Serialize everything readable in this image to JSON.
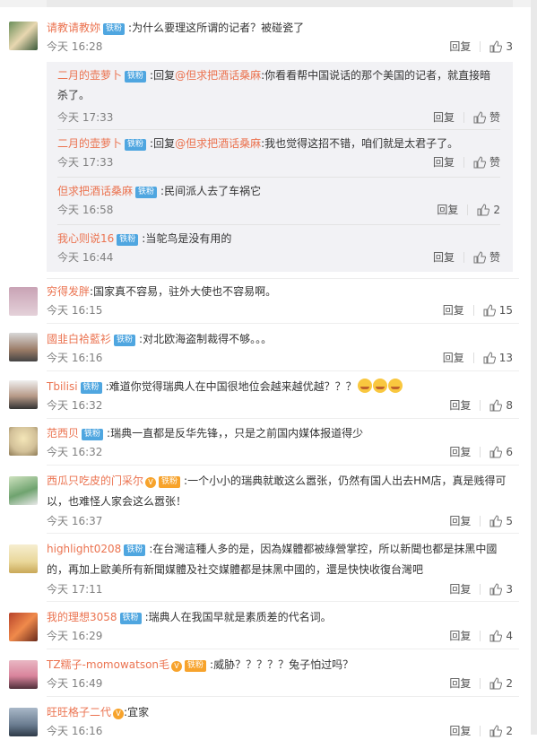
{
  "ui": {
    "reply": "回复",
    "like_zan": "赞",
    "badge_tiefen": "铁粉"
  },
  "comments": [
    {
      "user": "请教请教妳",
      "badge": "铁粉",
      "text": "为什么要理这所谓的记者？被碰瓷了",
      "time": "今天 16:28",
      "likes": "3",
      "replies": [
        {
          "user": "二月的壶萝卜",
          "badge": "铁粉",
          "reply_prefix": "回复",
          "at": "@但求把酒话桑麻",
          "text": ":你看看帮中国说话的那个美国的记者，就直接暗杀了。",
          "time": "今天 17:33",
          "likes": "赞"
        },
        {
          "user": "二月的壶萝卜",
          "badge": "铁粉",
          "reply_prefix": "回复",
          "at": "@但求把酒话桑麻",
          "text": ":我也觉得这招不错，咱们就是太君子了。",
          "time": "今天 17:33",
          "likes": "赞"
        },
        {
          "user": "但求把酒话桑麻",
          "badge": "铁粉",
          "text": "民间派人去了车祸它",
          "time": "今天 16:58",
          "likes": "2"
        },
        {
          "user": "我心则说16",
          "badge": "铁粉",
          "text": "当鸵鸟是没有用的",
          "time": "今天 16:44",
          "likes": "赞"
        }
      ]
    },
    {
      "user": "穷得发胖",
      "text": "国家真不容易，驻外大使也不容易啊。",
      "time": "今天 16:15",
      "likes": "15"
    },
    {
      "user": "國韭白袷藍衫",
      "badge": "铁粉",
      "text": "对北欧海盗制裁得不够。。。",
      "time": "今天 16:16",
      "likes": "13"
    },
    {
      "user": "Tbilisi",
      "badge": "铁粉",
      "text": "难道你觉得瑞典人在中国很地位会越来越优越？？？",
      "time": "今天 16:32",
      "likes": "8"
    },
    {
      "user": "范西贝",
      "badge": "铁粉",
      "text": "瑞典一直都是反华先锋，，只是之前国内媒体报道得少",
      "time": "今天 16:32",
      "likes": "6"
    },
    {
      "user": "西瓜只吃皮的门采尔",
      "badge": "铁粉",
      "text": "一个小小的瑞典就敢这么嚣张，仍然有国人出去HM店，真是贱得可",
      "text2": "以，也难怪人家会这么嚣张！",
      "time": "今天 16:37",
      "likes": "5"
    },
    {
      "user": "highlight0208",
      "badge": "铁粉",
      "text": "在台灣這種人多的是，因為媒體都被綠營掌控，所以新聞也都是抹黑中國",
      "text2": "的，再加上歐美所有新聞媒體及社交媒體都是抹黑中國的，還是快快收復台灣吧",
      "time": "今天 17:11",
      "likes": "3"
    },
    {
      "user": "我的理想3058",
      "badge": "铁粉",
      "text": "瑞典人在我国早就是素质差的代名词。",
      "time": "今天 16:29",
      "likes": "4"
    },
    {
      "user": "TZ糯子-momowatson毛",
      "badge": "铁粉",
      "text": "威胁？？？？？兔子怕过吗？",
      "time": "今天 16:49",
      "likes": "2"
    },
    {
      "user": "旺旺格子二代",
      "text": "宜家",
      "time": "今天 16:16",
      "likes": "2"
    }
  ]
}
